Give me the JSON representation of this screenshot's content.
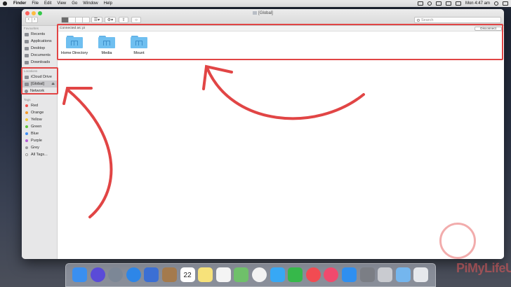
{
  "menubar": {
    "items": [
      "Finder",
      "File",
      "Edit",
      "View",
      "Go",
      "Window",
      "Help"
    ],
    "clock": "Mon 4:47 am"
  },
  "window": {
    "title": "[Global]"
  },
  "search": {
    "placeholder": "Search"
  },
  "sidebar": {
    "favourites_header": "Favourites",
    "favourites": [
      {
        "label": "Recents",
        "icon": "clock-icon"
      },
      {
        "label": "Applications",
        "icon": "applications-icon"
      },
      {
        "label": "Desktop",
        "icon": "desktop-icon"
      },
      {
        "label": "Documents",
        "icon": "document-icon"
      },
      {
        "label": "Downloads",
        "icon": "download-icon"
      }
    ],
    "locations_header": "Locations",
    "locations": [
      {
        "label": "iCloud Drive",
        "icon": "cloud-icon"
      },
      {
        "label": "[Global]",
        "icon": "server-icon"
      },
      {
        "label": "Network",
        "icon": "globe-icon"
      }
    ],
    "tags_header": "Tags",
    "tags": [
      {
        "label": "Red",
        "color": "#f0504a"
      },
      {
        "label": "Orange",
        "color": "#f59a2c"
      },
      {
        "label": "Yellow",
        "color": "#f5c93a"
      },
      {
        "label": "Green",
        "color": "#5cc33c"
      },
      {
        "label": "Blue",
        "color": "#3f8ef5"
      },
      {
        "label": "Purple",
        "color": "#b45fd6"
      },
      {
        "label": "Grey",
        "color": "#9a9a9e"
      },
      {
        "label": "All Tags...",
        "color": "#ffffff"
      }
    ]
  },
  "content": {
    "connected_text": "Connected as: pi",
    "disconnect_label": "Disconnect",
    "files": [
      {
        "label": "Home Directory",
        "icon": "folder-icon"
      },
      {
        "label": "Media",
        "icon": "folder-icon"
      },
      {
        "label": "Mount",
        "icon": "folder-icon"
      }
    ]
  },
  "dock": {
    "icons": [
      {
        "name": "finder",
        "color": "#3a8ff0"
      },
      {
        "name": "siri",
        "color": "#5a4bd8"
      },
      {
        "name": "launchpad",
        "color": "#7c8796"
      },
      {
        "name": "safari",
        "color": "#2d86e8"
      },
      {
        "name": "photo-app",
        "color": "#3b6fd4"
      },
      {
        "name": "contacts",
        "color": "#a47a4d"
      },
      {
        "name": "calendar",
        "color": "#ffffff",
        "text": "22"
      },
      {
        "name": "notes",
        "color": "#f7e27a"
      },
      {
        "name": "reminders",
        "color": "#f4f4f4"
      },
      {
        "name": "maps",
        "color": "#6fc06a"
      },
      {
        "name": "photos",
        "color": "#f2f2f2"
      },
      {
        "name": "messages",
        "color": "#37a8f5"
      },
      {
        "name": "facetime",
        "color": "#36b84a"
      },
      {
        "name": "news",
        "color": "#f24b52"
      },
      {
        "name": "music",
        "color": "#f04a6d"
      },
      {
        "name": "app-store",
        "color": "#2f8ff0"
      },
      {
        "name": "system-preferences",
        "color": "#7b7e85"
      },
      {
        "name": "disk-utility",
        "color": "#c9cbd0"
      },
      {
        "name": "downloads-stack",
        "color": "#74b6ee"
      },
      {
        "name": "trash",
        "color": "#e6e8ec"
      }
    ]
  },
  "watermark": {
    "text_a": "PiMy",
    "text_b": "LifeUp"
  }
}
